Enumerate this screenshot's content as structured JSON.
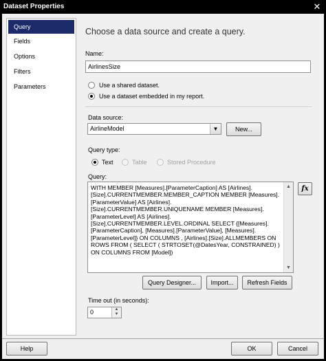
{
  "window": {
    "title": "Dataset Properties",
    "close_glyph": "✕"
  },
  "sidebar": {
    "items": [
      {
        "label": "Query",
        "selected": true
      },
      {
        "label": "Fields",
        "selected": false
      },
      {
        "label": "Options",
        "selected": false
      },
      {
        "label": "Filters",
        "selected": false
      },
      {
        "label": "Parameters",
        "selected": false
      }
    ]
  },
  "main": {
    "heading": "Choose a data source and create a query.",
    "name_label": "Name:",
    "name_value": "AirlinesSize",
    "radio_shared": "Use a shared dataset.",
    "radio_embedded": "Use a dataset embedded in my report.",
    "datasource_label": "Data source:",
    "datasource_value": "AirlineModel",
    "new_button": "New...",
    "query_type_label": "Query type:",
    "query_type_options": {
      "text": "Text",
      "table": "Table",
      "stored_procedure": "Stored Procedure"
    },
    "query_label": "Query:",
    "query_text": "WITH MEMBER [Measures].[ParameterCaption] AS [Airlines].\n[Size].CURRENTMEMBER.MEMBER_CAPTION MEMBER [Measures].\n[ParameterValue] AS [Airlines].\n[Size].CURRENTMEMBER.UNIQUENAME MEMBER [Measures].\n[ParameterLevel] AS [Airlines].\n[Size].CURRENTMEMBER.LEVEL.ORDINAL SELECT {[Measures].\n[ParameterCaption], [Measures].[ParameterValue], [Measures].\n[ParameterLevel]} ON COLUMNS , [Airlines].[Size].ALLMEMBERS ON\nROWS FROM ( SELECT ( STRTOSET(@DatesYear, CONSTRAINED) )\nON COLUMNS FROM [Model])",
    "fx_label": "fx",
    "query_designer_button": "Query Designer...",
    "import_button": "Import...",
    "refresh_fields_button": "Refresh Fields",
    "timeout_label": "Time out (in seconds):",
    "timeout_value": "0"
  },
  "footer": {
    "help_button": "Help",
    "ok_button": "OK",
    "cancel_button": "Cancel"
  }
}
